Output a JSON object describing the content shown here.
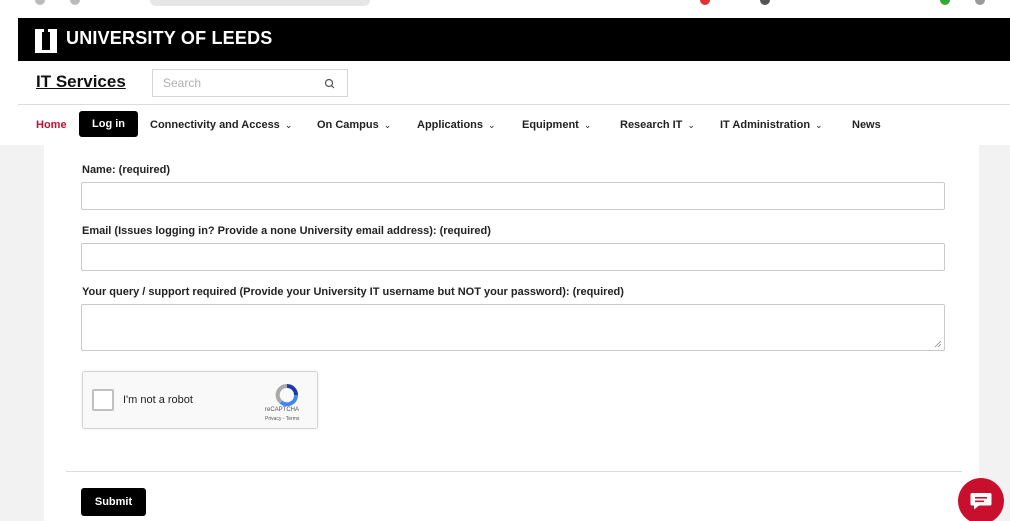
{
  "header": {
    "brand": "UNIVERSITY OF LEEDS"
  },
  "subheader": {
    "site_title": "IT Services",
    "search_placeholder": "Search"
  },
  "nav": {
    "home": "Home",
    "login": "Log in",
    "items": [
      {
        "label": "Connectivity and Access",
        "has_dropdown": true
      },
      {
        "label": "On Campus",
        "has_dropdown": true
      },
      {
        "label": "Applications",
        "has_dropdown": true
      },
      {
        "label": "Equipment",
        "has_dropdown": true
      },
      {
        "label": "Research IT",
        "has_dropdown": true
      },
      {
        "label": "IT Administration",
        "has_dropdown": true
      },
      {
        "label": "News",
        "has_dropdown": false
      }
    ]
  },
  "form": {
    "name_label": "Name: (required)",
    "name_value": "",
    "email_label": "Email (Issues logging in? Provide a none University email address): (required)",
    "email_value": "",
    "query_label": "Your query / support required (Provide your University IT username but NOT your password): (required)",
    "query_value": "",
    "submit_label": "Submit"
  },
  "recaptcha": {
    "label": "I'm not a robot",
    "brand": "reCAPTCHA",
    "terms": "Privacy - Terms"
  },
  "colors": {
    "brand_red": "#c8102e",
    "header_black": "#000000"
  },
  "icons": {
    "search": "search-icon",
    "chevron": "chevron-down-icon",
    "chat": "chat-icon",
    "recaptcha": "recaptcha-icon"
  }
}
